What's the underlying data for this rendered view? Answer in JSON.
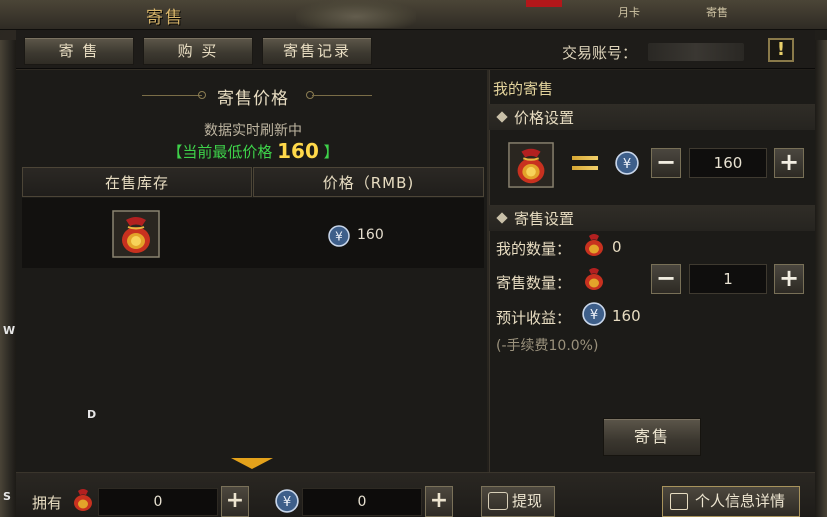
{
  "window": {
    "title": "寄售",
    "top_right_labels": [
      "月卡",
      "寄售"
    ]
  },
  "tabs": [
    {
      "label": "寄 售"
    },
    {
      "label": "购 买"
    },
    {
      "label": "寄售记录"
    }
  ],
  "account": {
    "label": "交易账号："
  },
  "info_button": {
    "glyph": "!"
  },
  "left_panel": {
    "title": "寄售价格",
    "refresh_note": "数据实时刷新中",
    "lowest_price_prefix": "【当前最低价格",
    "lowest_price_value": "160",
    "lowest_price_suffix": "】",
    "columns": [
      "在售库存",
      "价格（RMB)"
    ],
    "rows": [
      {
        "item_icon": "lucky-bag-icon",
        "price": "160"
      }
    ]
  },
  "right_panel": {
    "my_consign_title": "我的寄售",
    "price_setting_title": "价格设置",
    "price_value": "160",
    "consign_setting_title": "寄售设置",
    "my_quantity_label": "我的数量：",
    "my_quantity_value": "0",
    "consign_quantity_label": "寄售数量：",
    "consign_quantity_value": "1",
    "expected_income_label": "预计收益：",
    "expected_income_value": "160",
    "fee_note": "(-手续费10.0%)",
    "sell_button": "寄售"
  },
  "bottom_bar": {
    "own_label": "拥有",
    "bag_amount": "0",
    "coin_amount": "0",
    "withdraw_button": "提现",
    "profile_button": "个人信息详情"
  },
  "edge_letters": [
    "W",
    "D",
    "S"
  ],
  "colors": {
    "accent_gold": "#d8b56a",
    "price_green": "#3ed24a",
    "price_yellow": "#ffd94a",
    "arrow_orange": "#e4a21b"
  }
}
